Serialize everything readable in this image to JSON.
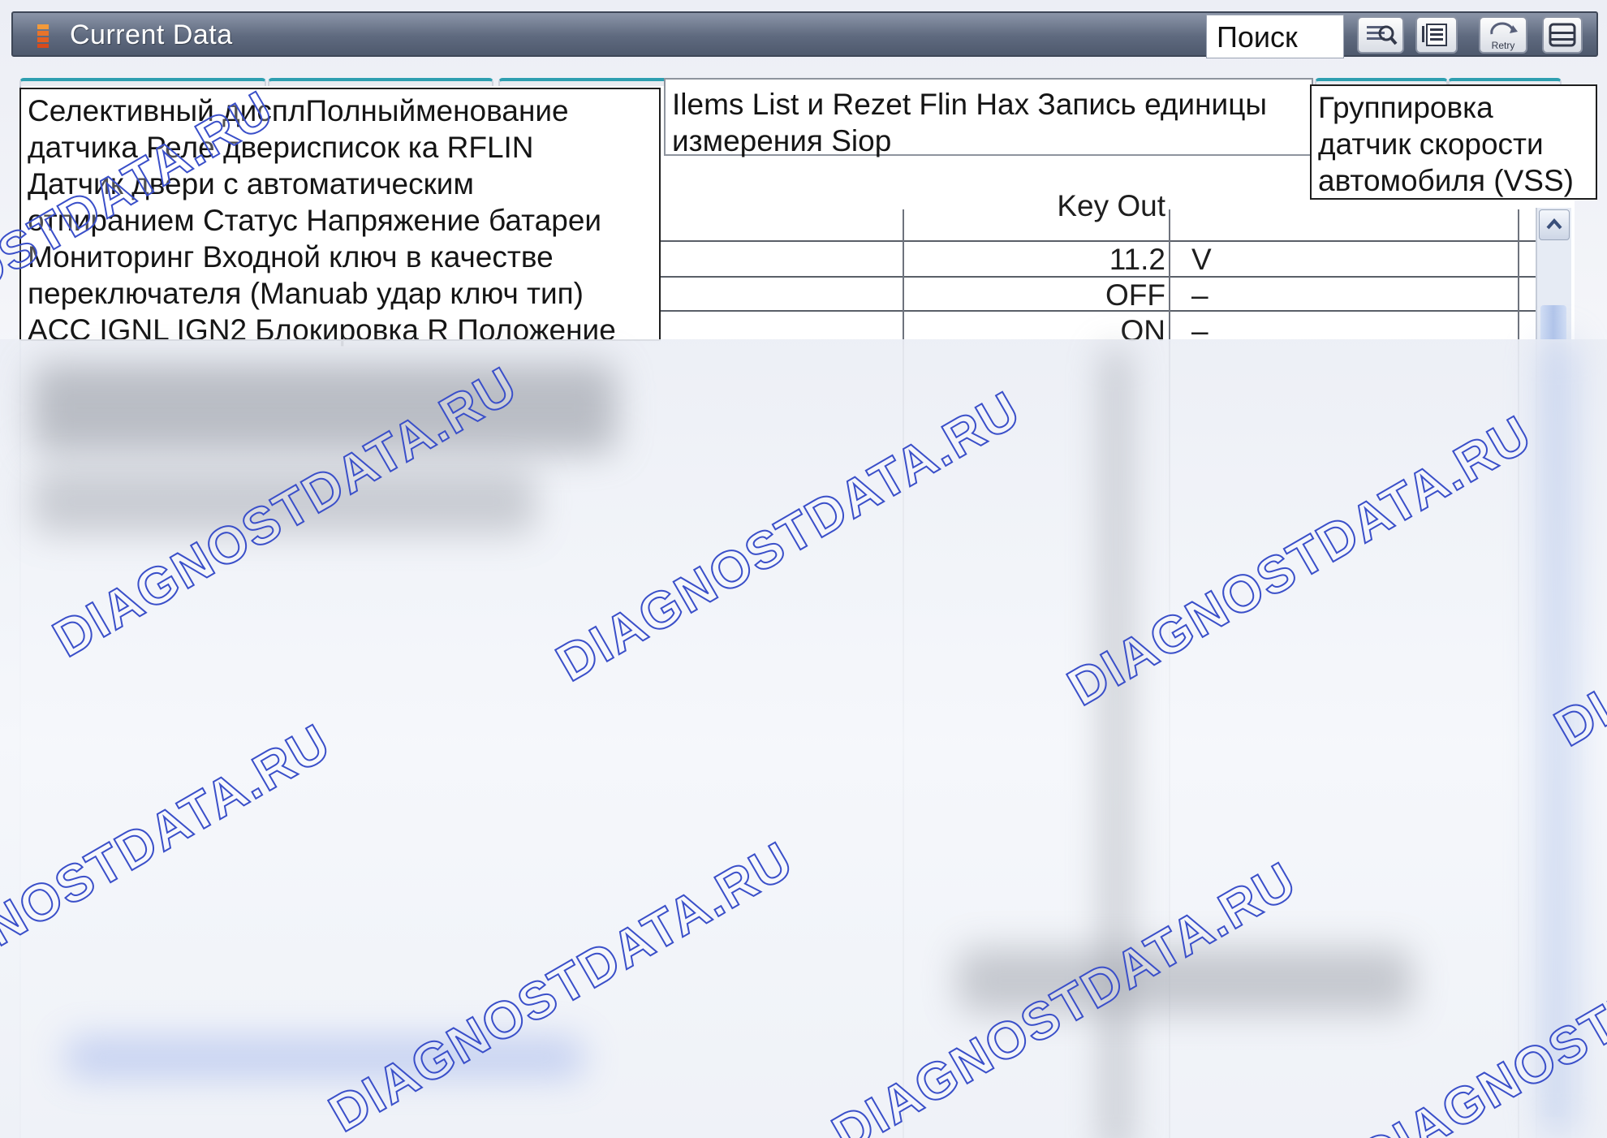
{
  "window": {
    "title": "Current Data",
    "search_value": "Поиск"
  },
  "toolbar": {
    "buttons": [
      {
        "icon": "zoom-icon"
      },
      {
        "icon": "list-icon"
      },
      {
        "icon": "retry-icon",
        "label": "Retry"
      },
      {
        "icon": "menu-icon"
      }
    ]
  },
  "tooltips": [
    {
      "text": "Селективный дисплПолныйменование\nдатчика Реле двериcписок ка RFLIN\nДатчик двери с автоматическим\nотпиранием Статус Напряжение батареи\nМониторинг Входной ключ в качестве\nпереключателя (Manuab удар ключ тип)\nACC IGNL IGN2 Блокировка R Положение"
    },
    {
      "text": "Ilems List и Rezet Flin Hax Запись единицы\nизмерения Siop"
    },
    {
      "text": "Группировка\nдатчик скорости\nавтомобиля (VSS)"
    }
  ],
  "table": {
    "header_partial": "Key Out",
    "rows": [
      {
        "value": "11.2",
        "unit": "V"
      },
      {
        "value": "OFF",
        "unit": "–"
      },
      {
        "value": "ON",
        "unit": "–"
      }
    ]
  },
  "watermark": {
    "text": "DIAGNOSTDATA.RU"
  },
  "colors": {
    "titlebar": "#5f6a7f",
    "tab_accent": "#2e9fb0",
    "watermark_stroke": "#3a4fc9"
  }
}
